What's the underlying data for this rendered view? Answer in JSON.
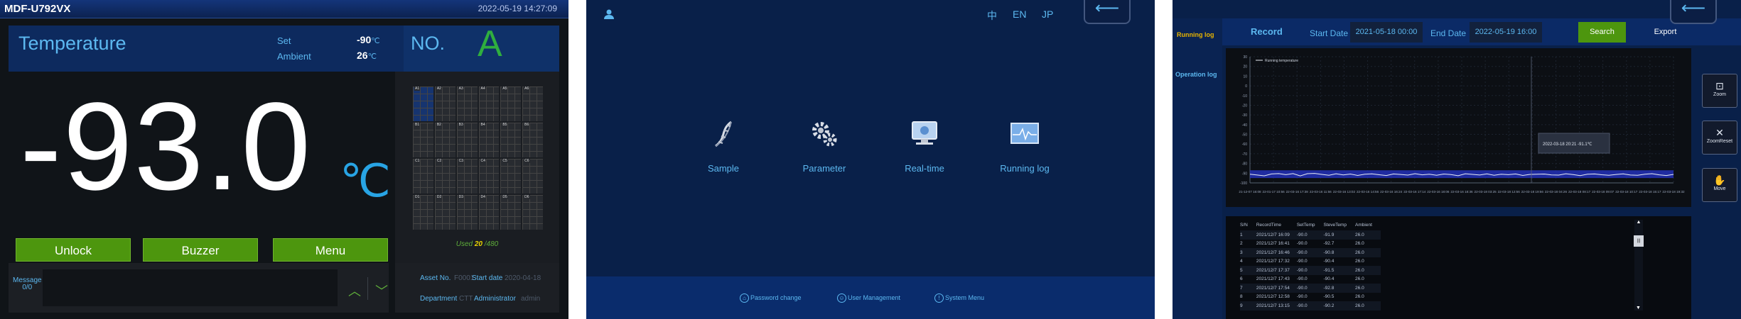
{
  "panel1": {
    "model": "MDF-U792VX",
    "datetime": "2022-05-19 14:27:09",
    "temperature_title": "Temperature",
    "set_label": "Set",
    "set_value": "-90",
    "ambient_label": "Ambient",
    "ambient_value": "26",
    "unit_small": "℃",
    "big_temp": "-93.0",
    "big_unit": "℃",
    "no_label": "NO.",
    "no_value": "A",
    "buttons": [
      "Unlock",
      "Buzzer",
      "Menu"
    ],
    "rack_labels": [
      "A1",
      "A2",
      "A3",
      "A4",
      "A5",
      "A6",
      "B1",
      "B2",
      "B3",
      "B4",
      "B5",
      "B6",
      "C1",
      "C2",
      "C3",
      "C4",
      "C5",
      "C6",
      "D1",
      "D2",
      "D3",
      "D4",
      "D5",
      "D6"
    ],
    "used_label": "Used",
    "used_value": "20",
    "used_total": "/480",
    "message_label": "Message",
    "message_count": "0/0",
    "arrow_up": "︿",
    "arrow_down": "﹀",
    "asset_no_label": "Asset No.",
    "asset_no_value": "F0001",
    "start_date_label": "Start date",
    "start_date_value": "2020-04-18",
    "department_label": "Department",
    "department_value": "CTT",
    "administrator_label": "Administrator",
    "administrator_value": "admin",
    "colors": {
      "accent": "#5cb8f0",
      "green": "#4d960e",
      "navy": "#0d2a5e"
    }
  },
  "panel2": {
    "user_icon": "user-icon",
    "languages": [
      "中",
      "EN",
      "JP"
    ],
    "back_icon": "arrow-left-icon",
    "menu": [
      {
        "label": "Sample",
        "icon": "dna-icon"
      },
      {
        "label": "Parameter",
        "icon": "gears-icon"
      },
      {
        "label": "Real-time",
        "icon": "monitor-icon"
      },
      {
        "label": "Running log",
        "icon": "waveform-icon"
      }
    ],
    "bottom": [
      "Password change",
      "User Management",
      "System Menu"
    ]
  },
  "panel3": {
    "tabs": [
      "Running log",
      "Operation log"
    ],
    "record_label": "Record",
    "start_date_label": "Start Date",
    "start_date_value": "2021-05-18 00:00",
    "end_date_label": "End Date",
    "end_date_value": "2022-05-19 16:00",
    "search_label": "Search",
    "export_label": "Export",
    "tools": [
      {
        "label": "Zoom",
        "icon": "zoom-icon"
      },
      {
        "label": "ZoomReset",
        "icon": "zoom-reset-icon"
      },
      {
        "label": "Move",
        "icon": "hand-icon"
      }
    ],
    "table": {
      "headers": [
        "S/N",
        "RecordTime",
        "SetTemp",
        "SteveTemp",
        "Ambient"
      ],
      "rows": [
        [
          "1",
          "2021/12/7 16:09",
          "-90.0",
          "-91.9",
          "26.0"
        ],
        [
          "2",
          "2021/12/7 16:41",
          "-90.0",
          "-92.7",
          "26.0"
        ],
        [
          "3",
          "2021/12/7 16:46",
          "-90.0",
          "-90.8",
          "26.0"
        ],
        [
          "4",
          "2021/12/7 17:32",
          "-90.0",
          "-90.4",
          "26.0"
        ],
        [
          "5",
          "2021/12/7 17:37",
          "-90.0",
          "-91.5",
          "26.0"
        ],
        [
          "6",
          "2021/12/7 17:43",
          "-90.0",
          "-90.4",
          "26.0"
        ],
        [
          "7",
          "2021/12/7 17:54",
          "-90.0",
          "-92.8",
          "26.0"
        ],
        [
          "8",
          "2021/12/7 12:58",
          "-90.0",
          "-90.5",
          "26.0"
        ],
        [
          "9",
          "2021/12/7 13:15",
          "-90.0",
          "-90.2",
          "26.0"
        ]
      ]
    },
    "scroll_up": "▲",
    "scroll_down": "▼",
    "scroll_thumb": "|||",
    "chart_data": {
      "type": "line",
      "series": [
        {
          "name": "Running temperature",
          "values_note": ""
        }
      ],
      "y_ticks": [
        "30",
        "20",
        "10",
        "0",
        "-10",
        "-20",
        "-30",
        "-40",
        "-50",
        "-60",
        "-70",
        "-80",
        "-90",
        "-100"
      ],
      "ylim": [
        -100,
        30
      ],
      "x_ticks": [
        "21-12-07 16:08",
        "22-01-17 10:56",
        "22-03-16 17:38",
        "22-03-16 11:56",
        "22-03-16 13:02",
        "22-03-16 14:56",
        "22-03-16 16:24",
        "22-03-16 17:14",
        "22-03-16 18:06",
        "22-03-16 18:36",
        "22-03-18 03:25",
        "22-03-18 12:56",
        "22-03-18 19:56",
        "22-03-18 04:26",
        "22-03-18 08:17",
        "22-03-18 09:07",
        "22-03-18 10:17",
        "22-03-18 15:17",
        "22-03-18 19:32"
      ],
      "tooltip": "2022-03-18 20:21 -91.1℃",
      "grid": true,
      "legend": "top-left",
      "values_y": [
        -91.0,
        -91.9,
        -92.7,
        -90.8,
        -90.4,
        -91.5,
        -90.4,
        -92.8,
        -90.5,
        -90.2,
        -91.2,
        -92.1,
        -90.6,
        -91.8,
        -90.9,
        -92.3,
        -91.0,
        -90.7,
        -91.6,
        -92.4,
        -90.8,
        -91.3,
        -92.0,
        -90.5,
        -91.7,
        -91.1,
        -92.2,
        -90.9,
        -91.4,
        -92.6,
        -90.6,
        -91.2,
        -91.9,
        -90.7,
        -92.1,
        -91.0,
        -91.5,
        -90.8,
        -92.3,
        -91.2,
        -91.1,
        -90.9,
        -91.8,
        -92.0,
        -90.6,
        -91.4,
        -92.5,
        -91.0,
        -90.8,
        -91.6,
        -92.2,
        -91.3,
        -90.7,
        -91.9,
        -92.1,
        -91.0,
        -90.5,
        -91.7,
        -92.4,
        -91.2
      ]
    }
  }
}
